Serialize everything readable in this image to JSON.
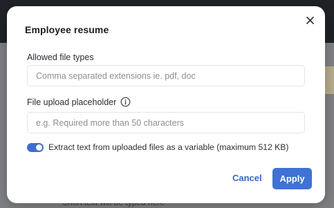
{
  "background": {
    "peek_text": "Short text will be typed here"
  },
  "dialog": {
    "title": "Employee resume",
    "close_icon": "close-icon",
    "allowed_types": {
      "label": "Allowed file types",
      "value": "",
      "placeholder": "Comma separated extensions ie. pdf, doc"
    },
    "upload_placeholder": {
      "label": "File upload placeholder",
      "info_icon": "info-icon",
      "value": "",
      "placeholder": "e.g. Required more than 50 characters"
    },
    "extract_text": {
      "label": "Extract text from uploaded files as a variable (maximum 512 KB)",
      "enabled": true
    },
    "cancel_label": "Cancel",
    "apply_label": "Apply"
  },
  "colors": {
    "accent": "#3e72d4",
    "toggle_on": "#3d6fd0",
    "title": "#1b1d21"
  }
}
